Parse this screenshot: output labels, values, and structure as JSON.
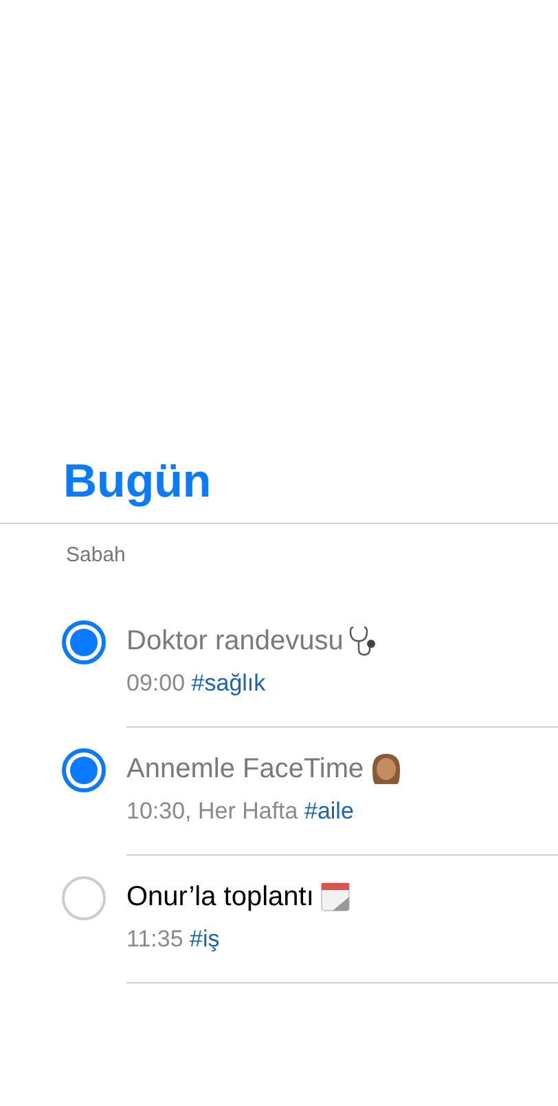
{
  "title": "Bugün",
  "section": "Sabah",
  "reminders": [
    {
      "title": "Doktor randevusu",
      "kind": "stethoscope",
      "time": "09:00",
      "tag": "#sağlık",
      "completed": true
    },
    {
      "title": "Annemle FaceTime",
      "kind": "person",
      "time": "10:30, Her Hafta",
      "tag": "#aile",
      "completed": true
    },
    {
      "title": "Onur’la toplantı",
      "kind": "calendar",
      "time": "11:35",
      "tag": "#iş",
      "completed": false
    }
  ]
}
